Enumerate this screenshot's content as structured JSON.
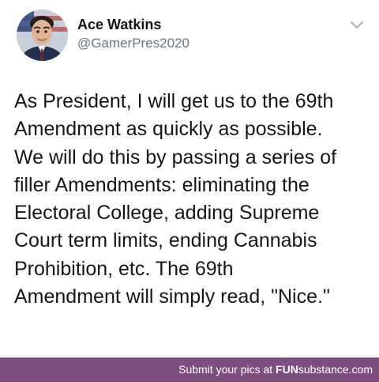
{
  "tweet": {
    "author": {
      "display_name": "Ace Watkins",
      "handle": "@GamerPres2020"
    },
    "text_lines": [
      "As President, I will get us to the 69th",
      "Amendment as quickly as possible.",
      "We will do this by passing a series of",
      "filler Amendments: eliminating the",
      "Electoral College, adding Supreme",
      "Court term limits, ending Cannabis",
      "Prohibition, etc. The 69th",
      "Amendment will simply read, \"Nice.\""
    ]
  },
  "footer": {
    "prefix": "Submit your pics at ",
    "brand_bold": "FUN",
    "brand_rest": "substance",
    "suffix": ".com"
  },
  "colors": {
    "name": "#14171a",
    "handle": "#657786",
    "footer_bg": "#7d4f7f"
  },
  "icons": {
    "menu": "chevron-down-icon"
  }
}
